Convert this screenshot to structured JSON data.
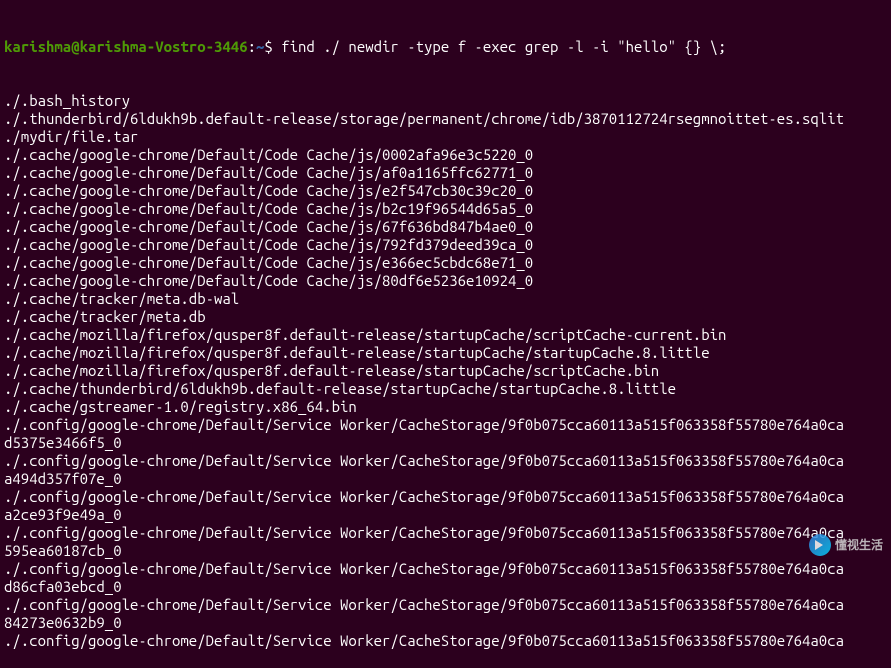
{
  "prompt": {
    "user_host": "karishma@karishma-Vostro-3446",
    "colon": ":",
    "path": "~",
    "dollar": "$ "
  },
  "command": "find ./ newdir -type f -exec grep -l -i \"hello\" {} \\;",
  "output": [
    "./.bash_history",
    "./.thunderbird/6ldukh9b.default-release/storage/permanent/chrome/idb/3870112724rsegmnoittet-es.sqlit",
    "./mydir/file.tar",
    "./.cache/google-chrome/Default/Code Cache/js/0002afa96e3c5220_0",
    "./.cache/google-chrome/Default/Code Cache/js/af0a1165ffc62771_0",
    "./.cache/google-chrome/Default/Code Cache/js/e2f547cb30c39c20_0",
    "./.cache/google-chrome/Default/Code Cache/js/b2c19f96544d65a5_0",
    "./.cache/google-chrome/Default/Code Cache/js/67f636bd847b4ae0_0",
    "./.cache/google-chrome/Default/Code Cache/js/792fd379deed39ca_0",
    "./.cache/google-chrome/Default/Code Cache/js/e366ec5cbdc68e71_0",
    "./.cache/google-chrome/Default/Code Cache/js/80df6e5236e10924_0",
    "./.cache/tracker/meta.db-wal",
    "./.cache/tracker/meta.db",
    "./.cache/mozilla/firefox/qusper8f.default-release/startupCache/scriptCache-current.bin",
    "./.cache/mozilla/firefox/qusper8f.default-release/startupCache/startupCache.8.little",
    "./.cache/mozilla/firefox/qusper8f.default-release/startupCache/scriptCache.bin",
    "./.cache/thunderbird/6ldukh9b.default-release/startupCache/startupCache.8.little",
    "./.cache/gstreamer-1.0/registry.x86_64.bin",
    "./.config/google-chrome/Default/Service Worker/CacheStorage/9f0b075cca60113a515f063358f55780e764a0ca",
    "d5375e3466f5_0",
    "./.config/google-chrome/Default/Service Worker/CacheStorage/9f0b075cca60113a515f063358f55780e764a0ca",
    "a494d357f07e_0",
    "./.config/google-chrome/Default/Service Worker/CacheStorage/9f0b075cca60113a515f063358f55780e764a0ca",
    "a2ce93f9e49a_0",
    "./.config/google-chrome/Default/Service Worker/CacheStorage/9f0b075cca60113a515f063358f55780e764a0ca",
    "595ea60187cb_0",
    "./.config/google-chrome/Default/Service Worker/CacheStorage/9f0b075cca60113a515f063358f55780e764a0ca",
    "d86cfa03ebcd_0",
    "./.config/google-chrome/Default/Service Worker/CacheStorage/9f0b075cca60113a515f063358f55780e764a0ca",
    "84273e0632b9_0",
    "./.config/google-chrome/Default/Service Worker/CacheStorage/9f0b075cca60113a515f063358f55780e764a0ca"
  ],
  "watermark": "懂视生活"
}
